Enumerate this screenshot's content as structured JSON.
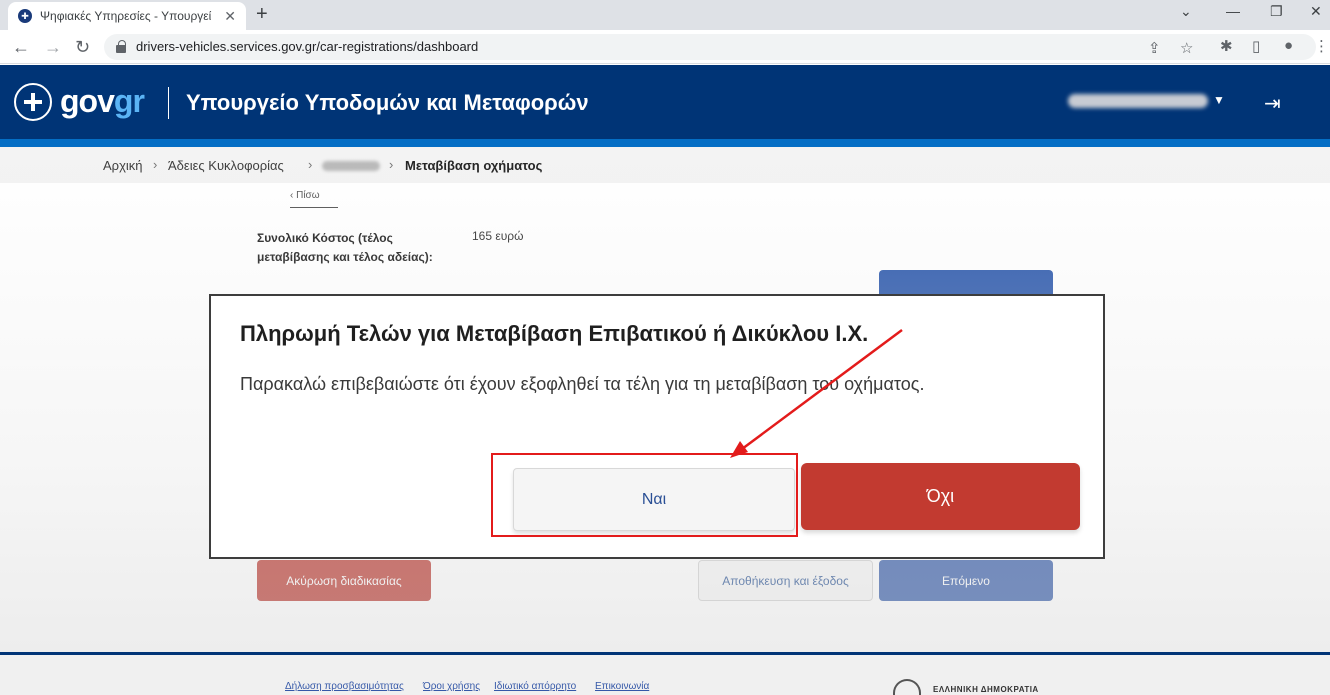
{
  "browser": {
    "tab_title": "Ψηφιακές Υπηρεσίες - Υπουργεί",
    "url": "drivers-vehicles.services.gov.gr/car-registrations/dashboard"
  },
  "header": {
    "logo_gov": "gov",
    "logo_gr": "gr",
    "ministry": "Υπουργείο Υποδομών και Μεταφορών"
  },
  "breadcrumb": {
    "home": "Αρχική",
    "licenses": "Άδειες Κυκλοφορίας",
    "current": "Μεταβίβαση οχήματος"
  },
  "page": {
    "back_label": "Πίσω",
    "cost_label": "Συνολικό Κόστος (τέλος μεταβίβασης και τέλος αδείας):",
    "cost_value": "165 ευρώ",
    "cancel_label": "Ακύρωση διαδικασίας",
    "save_exit_label": "Αποθήκευση και έξοδος",
    "next_label": "Επόμενο"
  },
  "modal": {
    "title": "Πληρωμή Τελών για Μεταβίβαση Επιβατικού ή Δικύκλου Ι.Χ.",
    "message": "Παρακαλώ επιβεβαιώστε ότι έχουν εξοφληθεί τα τέλη για τη μεταβίβαση του οχήματος.",
    "yes_label": "Ναι",
    "no_label": "Όχι"
  },
  "footer": {
    "links": [
      "Δήλωση προσβασιμότητας",
      "Όροι χρήσης",
      "Ιδιωτικό απόρρητο",
      "Επικοινωνία"
    ],
    "republic": "ΕΛΛΗΝΙΚΗ ΔΗΜΟΚΡΑΤΙΑ"
  },
  "colors": {
    "gov_blue": "#003476",
    "gov_light_blue": "#046ec5",
    "primary_button": "#2d55a5",
    "danger_button": "#c23a30",
    "annotation_red": "#e31b1b"
  },
  "icons": {
    "back": "chevron-left-icon",
    "forward": "arrow-right-icon",
    "reload": "reload-icon",
    "lock": "lock-icon",
    "share": "share-icon",
    "bookmark": "star-icon",
    "extensions": "puzzle-icon",
    "sidepanel": "sidepanel-icon",
    "profile": "profile-icon",
    "menu": "kebab-menu-icon",
    "logout": "logout-icon"
  }
}
